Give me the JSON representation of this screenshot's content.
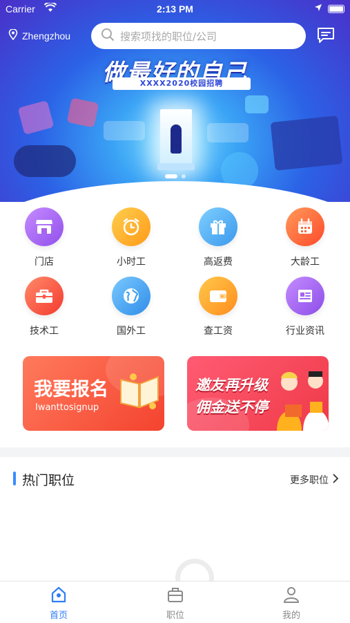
{
  "status_bar": {
    "carrier": "Carrier",
    "time": "2:13 PM"
  },
  "header": {
    "city": "Zhengzhou",
    "search_placeholder": "搜索项找的职位/公司"
  },
  "banner": {
    "headline": "做最好的自己",
    "subtitle": "XXXX2020校园招聘",
    "active_slide": 1,
    "slide_count": 3
  },
  "categories": [
    {
      "label": "门店",
      "icon": "store-icon",
      "color": "#a663f0"
    },
    {
      "label": "小时工",
      "icon": "alarm-clock-icon",
      "color": "#ffb02e"
    },
    {
      "label": "高返费",
      "icon": "gift-icon",
      "color": "#4fb3f5"
    },
    {
      "label": "大龄工",
      "icon": "calendar-icon",
      "color": "#ff6a3d"
    },
    {
      "label": "技术工",
      "icon": "toolbox-icon",
      "color": "#ff5a4a"
    },
    {
      "label": "国外工",
      "icon": "globe-icon",
      "color": "#3fa2f2"
    },
    {
      "label": "查工资",
      "icon": "wallet-icon",
      "color": "#ffa42e"
    },
    {
      "label": "行业资讯",
      "icon": "news-icon",
      "color": "#a663f0"
    }
  ],
  "promos": {
    "signup": {
      "title": "我要报名",
      "subtitle": "Iwanttosignup"
    },
    "invite": {
      "line1": "邀友再升级",
      "line2": "佣金送不停"
    }
  },
  "hot_jobs": {
    "title": "热门职位",
    "more": "更多职位"
  },
  "tabbar": [
    {
      "label": "首页",
      "icon": "home-icon",
      "active": true
    },
    {
      "label": "职位",
      "icon": "briefcase-icon",
      "active": false
    },
    {
      "label": "我的",
      "icon": "user-icon",
      "active": false
    }
  ],
  "colors": {
    "accent": "#2f7df6",
    "promo_red": "#f4432f"
  }
}
